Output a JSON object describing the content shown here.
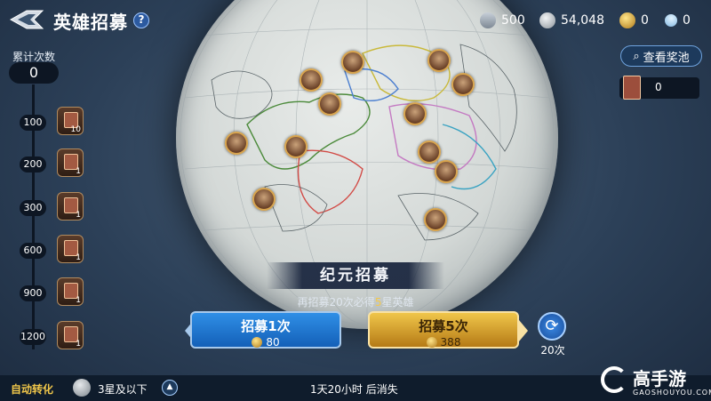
{
  "header": {
    "title": "英雄招募",
    "help": "?",
    "resources": [
      {
        "icon": "crown-icon",
        "value": "500"
      },
      {
        "icon": "silver-coin-icon",
        "value": "54,048"
      },
      {
        "icon": "gold-coin-icon",
        "value": "0"
      },
      {
        "icon": "diamond-icon",
        "value": "0"
      }
    ]
  },
  "left": {
    "count_label": "累计次数",
    "count_value": "0",
    "milestones": [
      {
        "threshold": "100",
        "reward_count": "10"
      },
      {
        "threshold": "200",
        "reward_count": "1"
      },
      {
        "threshold": "300",
        "reward_count": "1"
      },
      {
        "threshold": "600",
        "reward_count": "1"
      },
      {
        "threshold": "900",
        "reward_count": "1"
      },
      {
        "threshold": "1200",
        "reward_count": "1"
      }
    ]
  },
  "right": {
    "pool_button": "查看奖池",
    "pool_item_count": "0"
  },
  "recruit": {
    "banner": "纪元招募",
    "sub_prefix": "再招募20次必得",
    "sub_highlight": "5",
    "sub_suffix": "星英雄",
    "single_label": "招募1次",
    "single_cost": "80",
    "multi_label": "招募5次",
    "multi_cost": "388",
    "refresh_label": "20次"
  },
  "bottom": {
    "auto_label": "自动转化",
    "auto_value": "3星及以下",
    "expire": "1天20小时 后消失"
  },
  "watermark": {
    "title": "高手游",
    "sub": "GAOSHOUYOU.COM"
  },
  "colors": {
    "accent_gold": "#f5c94a",
    "button_blue": "#1f79d6",
    "button_gold": "#d9a336"
  }
}
